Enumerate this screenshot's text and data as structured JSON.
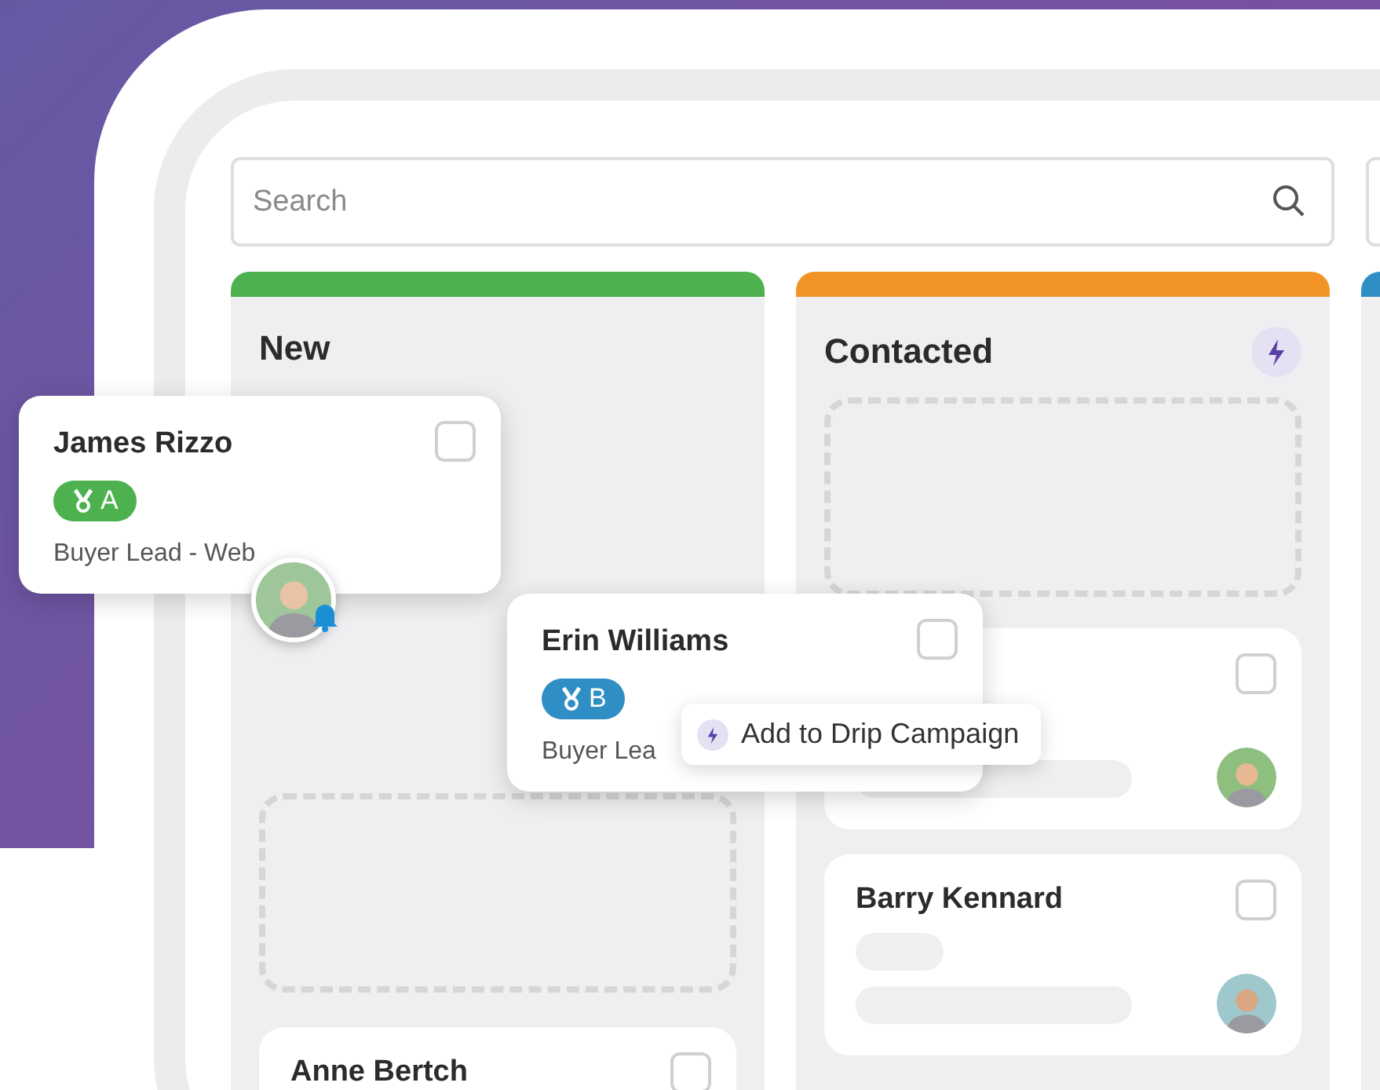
{
  "search": {
    "placeholder": "Search"
  },
  "columns": [
    {
      "title": "New",
      "color": "#4db14f",
      "automation": false,
      "items": [
        {
          "kind": "drop_zone"
        },
        {
          "kind": "card",
          "name": "Anne Bertch",
          "checked": false
        }
      ]
    },
    {
      "title": "Contacted",
      "color": "#f29325",
      "automation": true,
      "items": [
        {
          "kind": "drop_zone"
        },
        {
          "kind": "contact_card",
          "checked": false
        },
        {
          "kind": "contact_card",
          "name": "Barry Kennard",
          "checked": false
        }
      ]
    },
    {
      "color": "#2f8fc4"
    }
  ],
  "dragged_cards": [
    {
      "name": "James Rizzo",
      "grade": "A",
      "color": "#4db14f",
      "source": "Buyer Lead - Web",
      "checked": false,
      "notification": true
    },
    {
      "name": "Erin Williams",
      "grade": "B",
      "color": "#2f8fc4",
      "source": "Buyer Lea",
      "checked": false,
      "notification": false
    }
  ],
  "action": {
    "label": "Add to Drip Campaign"
  }
}
